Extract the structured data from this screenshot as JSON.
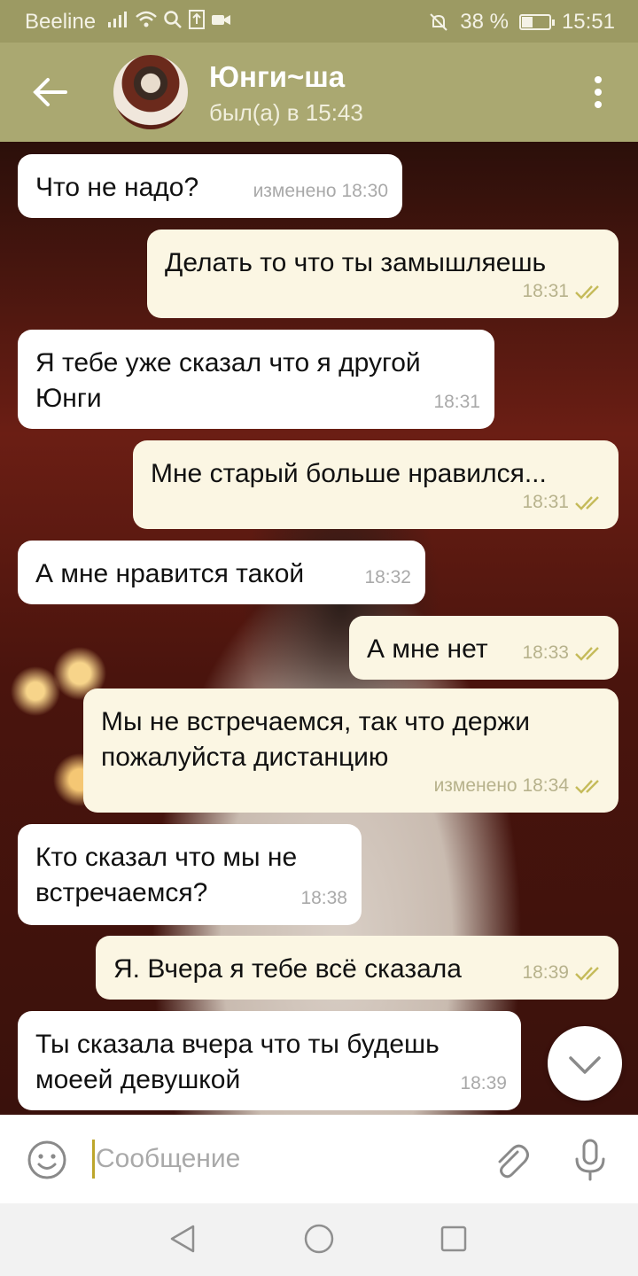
{
  "status_bar": {
    "carrier": "Beeline",
    "battery": "38 %",
    "time": "15:51"
  },
  "header": {
    "contact_name": "Юнги~ша",
    "status": "был(а) в 15:43"
  },
  "messages": [
    {
      "direction": "in",
      "text": "Что не надо?",
      "time": "изменено 18:30",
      "read": false
    },
    {
      "direction": "out",
      "text": "Делать то что ты замышляешь",
      "time": "18:31",
      "read": true
    },
    {
      "direction": "in",
      "text": "Я тебе уже сказал что я другой Юнги",
      "time": "18:31",
      "read": false
    },
    {
      "direction": "out",
      "text": "Мне старый больше нравился...",
      "time": "18:31",
      "read": true
    },
    {
      "direction": "in",
      "text": "А мне нравится такой",
      "time": "18:32",
      "read": false
    },
    {
      "direction": "out",
      "text": "А мне нет",
      "time": "18:33",
      "read": true
    },
    {
      "direction": "out",
      "text": "Мы не встречаемся, так что держи пожалуйста дистанцию",
      "time": "изменено 18:34",
      "read": true
    },
    {
      "direction": "in",
      "text": "Кто сказал что мы не встречаемся?",
      "time": "18:38",
      "read": false
    },
    {
      "direction": "out",
      "text": "Я. Вчера я тебе всё сказала",
      "time": "18:39",
      "read": true
    },
    {
      "direction": "in",
      "text": "Ты сказала вчера что ты будешь моеей девушкой",
      "time": "18:39",
      "read": false
    }
  ],
  "input": {
    "placeholder": "Сообщение"
  },
  "colors": {
    "header": "#aaa871",
    "status_bar": "#9c9a63",
    "outgoing_bubble": "#fbf6e3",
    "incoming_bubble": "#ffffff",
    "read_ticks": "#c5bb5a",
    "caret": "#bda62b"
  },
  "icons": {
    "back": "arrow-left-icon",
    "menu": "more-vertical-icon",
    "emoji": "smile-icon",
    "attach": "paperclip-icon",
    "mic": "microphone-icon",
    "scroll": "chevron-down-icon"
  }
}
